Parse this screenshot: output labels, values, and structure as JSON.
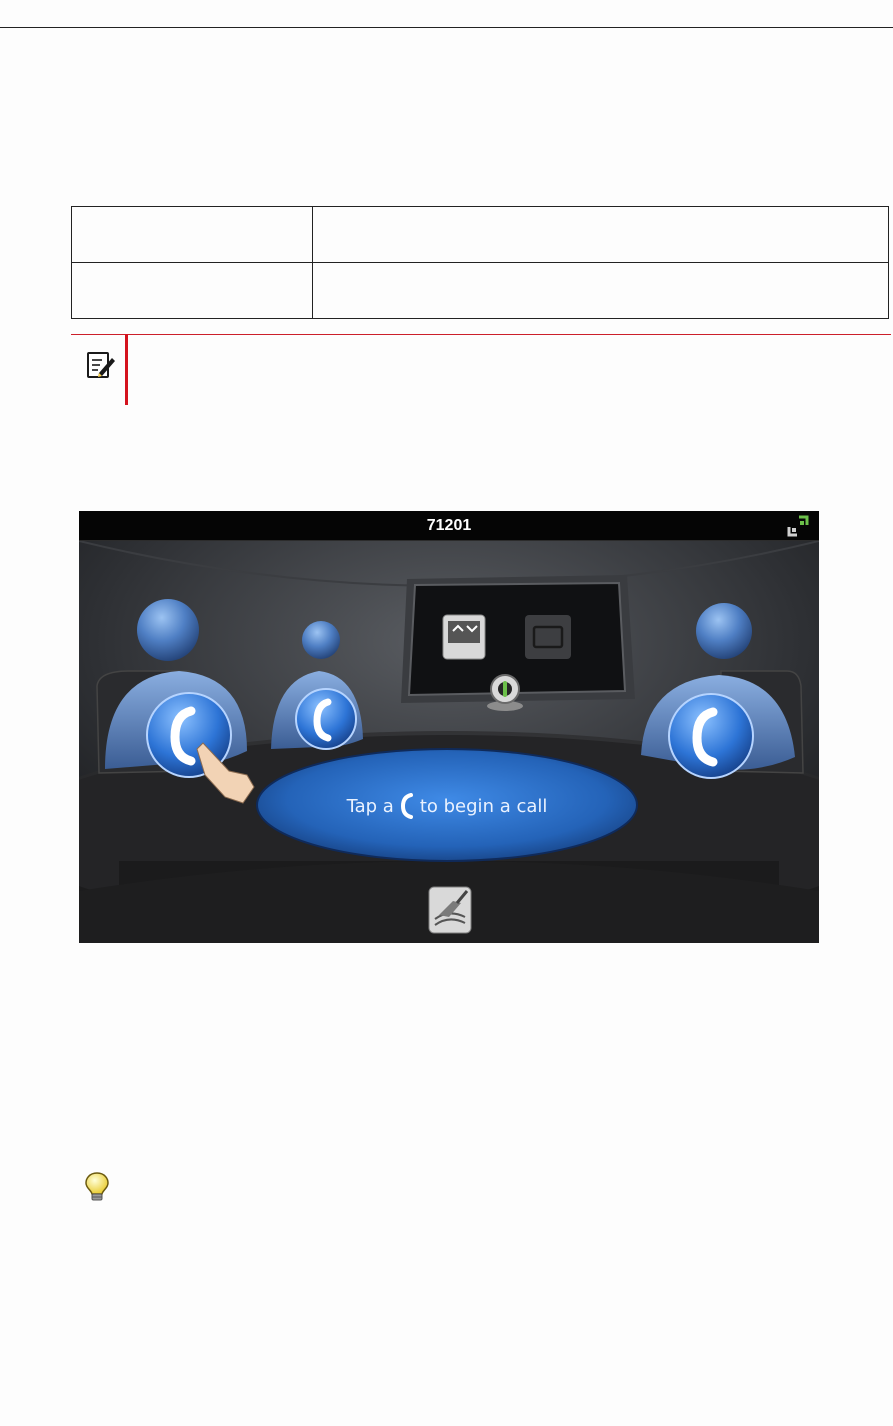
{
  "info_table": {
    "rows": [
      {
        "label": "",
        "description": ""
      },
      {
        "label": "",
        "description": ""
      }
    ]
  },
  "note": {
    "icon": "note-pencil-icon"
  },
  "screenshot": {
    "title": "71201",
    "fullscreen_icon": "fullscreen-icon",
    "hint_prefix": "Tap a",
    "hint_suffix": "to begin a call",
    "participants": [
      {
        "position": "left",
        "icon": "handset-icon"
      },
      {
        "position": "back-left",
        "icon": "handset-icon"
      },
      {
        "position": "right",
        "icon": "handset-icon"
      }
    ],
    "monitor_icons": [
      "screen-share-icon",
      "video-camera-icon"
    ],
    "camera_icon": "webcam-icon",
    "clear_icon": "broom-icon",
    "colors": {
      "accent_blue": "#2f7fd8",
      "status_green": "#6cc04a"
    }
  },
  "tip": {
    "icon": "lightbulb-icon"
  }
}
